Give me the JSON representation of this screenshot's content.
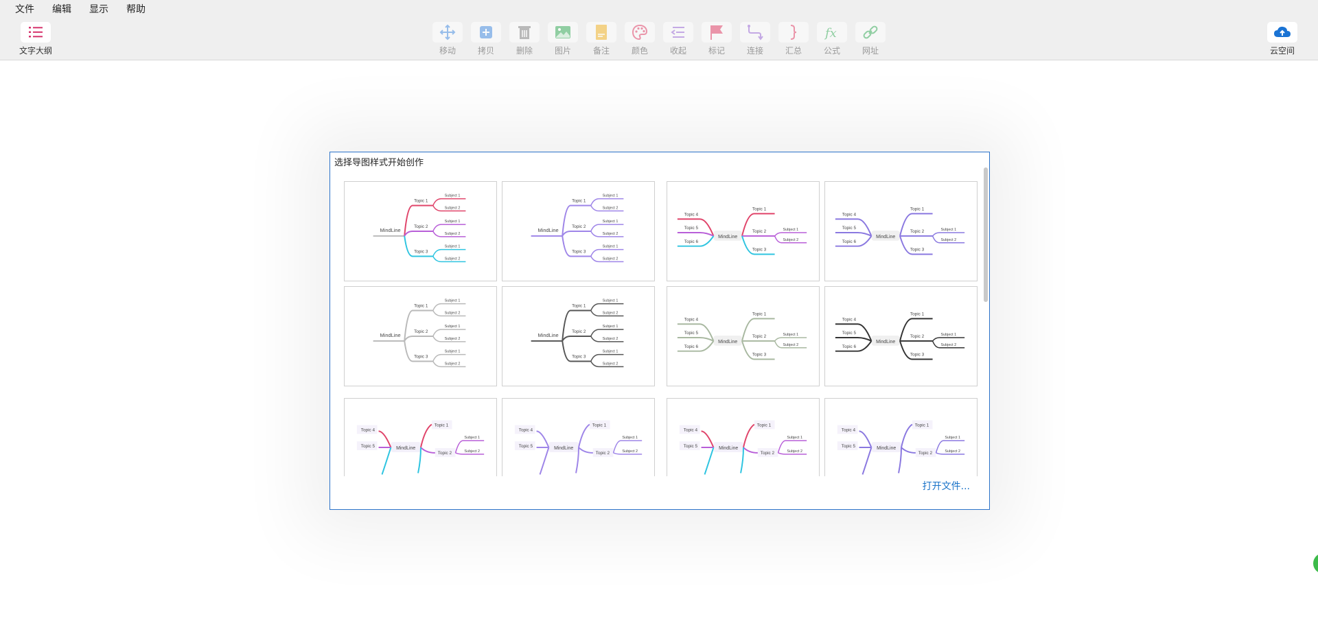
{
  "menu": [
    "文件",
    "编辑",
    "显示",
    "帮助"
  ],
  "outline": {
    "label": "文字大纲"
  },
  "toolbar": [
    {
      "label": "移动",
      "icon": "move-icon",
      "color": "#4a8fe0"
    },
    {
      "label": "拷贝",
      "icon": "copy-icon",
      "color": "#4a8fe0"
    },
    {
      "label": "删除",
      "icon": "trash-icon",
      "color": "#888888"
    },
    {
      "label": "图片",
      "icon": "image-icon",
      "color": "#3dae5d"
    },
    {
      "label": "备注",
      "icon": "note-icon",
      "color": "#f0b42c"
    },
    {
      "label": "颜色",
      "icon": "palette-icon",
      "color": "#e0446a"
    },
    {
      "label": "收起",
      "icon": "collapse-icon",
      "color": "#9b6bd6"
    },
    {
      "label": "标记",
      "icon": "flag-icon",
      "color": "#e0446a"
    },
    {
      "label": "连接",
      "icon": "connect-icon",
      "color": "#9b6bd6"
    },
    {
      "label": "汇总",
      "icon": "brace-icon",
      "color": "#e0446a"
    },
    {
      "label": "公式",
      "icon": "formula-icon",
      "color": "#3dae5d"
    },
    {
      "label": "网址",
      "icon": "link-icon",
      "color": "#3dae5d"
    }
  ],
  "cloud": {
    "label": "云空间"
  },
  "dialog": {
    "title": "选择导图样式开始创作",
    "open_file": "打开文件...",
    "text": {
      "center": "MindLine",
      "topics": [
        "Topic 1",
        "Topic 2",
        "Topic 3",
        "Topic 4",
        "Topic 5",
        "Topic 6"
      ],
      "subjects": [
        "Subject 1",
        "Subject 2"
      ]
    },
    "templates": [
      {
        "layout": "right",
        "colors": [
          "#e0446a",
          "#b85ed8",
          "#2ec4e0"
        ],
        "center_color": "#bbbbbb"
      },
      {
        "layout": "right",
        "colors": [
          "#9e85e8",
          "#9e85e8",
          "#9e85e8"
        ],
        "center_color": "#9e85e8"
      },
      {
        "layout": "both",
        "colors": [
          "#e0446a",
          "#b85ed8",
          "#2ec4e0"
        ],
        "center_color": "#bbbbbb"
      },
      {
        "layout": "both",
        "colors": [
          "#8a78e0",
          "#8a78e0",
          "#8a78e0"
        ],
        "center_color": "#8a78e0"
      },
      {
        "layout": "right",
        "colors": [
          "#b9b9b9",
          "#b9b9b9",
          "#b9b9b9"
        ],
        "center_color": "#b9b9b9"
      },
      {
        "layout": "right",
        "colors": [
          "#555555",
          "#555555",
          "#555555"
        ],
        "center_color": "#555555"
      },
      {
        "layout": "both",
        "colors": [
          "#a8b8a0",
          "#a8b8a0",
          "#a8b8a0"
        ],
        "center_color": "#a8b8a0"
      },
      {
        "layout": "both",
        "colors": [
          "#333333",
          "#333333",
          "#333333"
        ],
        "center_color": "#333333"
      },
      {
        "layout": "boxed",
        "colors": [
          "#e0446a",
          "#b85ed8",
          "#2ec4e0"
        ],
        "center_color": "#bbbbbb"
      },
      {
        "layout": "boxed",
        "colors": [
          "#9e85e8",
          "#9e85e8",
          "#9e85e8"
        ],
        "center_color": "#9e85e8"
      },
      {
        "layout": "boxed",
        "colors": [
          "#e0446a",
          "#b85ed8",
          "#2ec4e0"
        ],
        "center_color": "#bbbbbb"
      },
      {
        "layout": "boxed",
        "colors": [
          "#8a78e0",
          "#8a78e0",
          "#8a78e0"
        ],
        "center_color": "#8a78e0"
      }
    ]
  }
}
